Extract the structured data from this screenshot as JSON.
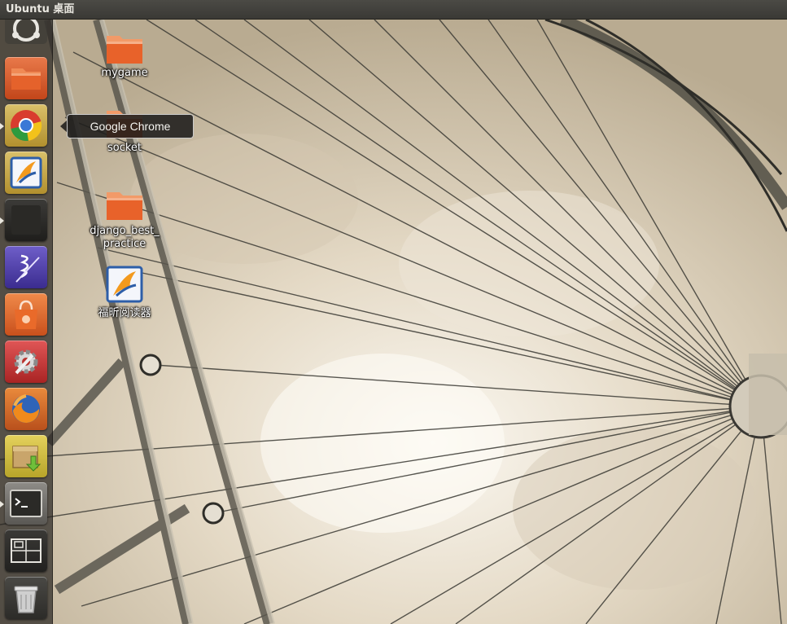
{
  "panel": {
    "title": "Ubuntu 桌面"
  },
  "launcher": {
    "items": [
      {
        "name": "dash-home",
        "icon": "ubuntu-logo-icon"
      },
      {
        "name": "home-folder",
        "icon": "folder-icon"
      },
      {
        "name": "google-chrome",
        "icon": "chrome-icon",
        "running": true
      },
      {
        "name": "foxit-reader",
        "icon": "foxit-icon"
      },
      {
        "name": "running-app",
        "icon": "dark-app-icon",
        "running": true
      },
      {
        "name": "emacs",
        "icon": "emacs-icon"
      },
      {
        "name": "software-center",
        "icon": "shopping-bag-icon"
      },
      {
        "name": "system-settings",
        "icon": "settings-icon"
      },
      {
        "name": "firefox",
        "icon": "firefox-icon"
      },
      {
        "name": "archive-manager",
        "icon": "package-icon"
      },
      {
        "name": "terminal",
        "icon": "terminal-icon",
        "running": true
      },
      {
        "name": "workspace-switcher",
        "icon": "workspaces-icon"
      },
      {
        "name": "trash",
        "icon": "trash-icon"
      }
    ]
  },
  "tooltip": {
    "text": "Google Chrome"
  },
  "desktop": {
    "icons": [
      {
        "label": "mygame",
        "icon": "folder-icon"
      },
      {
        "label": "socket",
        "icon": "folder-icon"
      },
      {
        "label": "django_best_",
        "label2": "practice",
        "icon": "folder-icon"
      },
      {
        "label": "福昕阅读器",
        "icon": "foxit-icon"
      }
    ]
  },
  "colors": {
    "panel_bg": "#3f3e39",
    "folder_orange": "#e8622a",
    "tooltip_bg": "#1e1d1b"
  }
}
